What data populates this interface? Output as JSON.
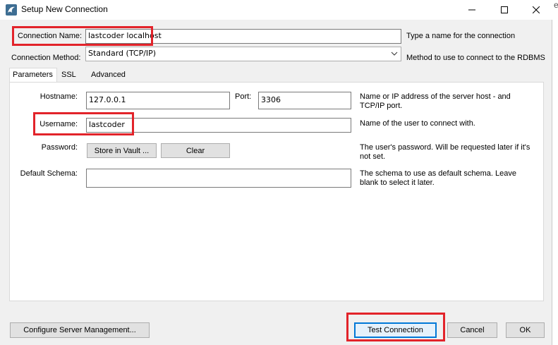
{
  "window": {
    "title": "Setup New Connection",
    "controls": {
      "minimize": "—",
      "maximize": "☐",
      "close": "✕"
    },
    "edge_char": "e"
  },
  "connection_name": {
    "label": "Connection Name:",
    "value": "lastcoder localhost",
    "hint": "Type a name for the connection"
  },
  "connection_method": {
    "label": "Connection Method:",
    "value": "Standard (TCP/IP)",
    "hint": "Method to use to connect to the RDBMS"
  },
  "tabs": [
    {
      "label": "Parameters",
      "active": true
    },
    {
      "label": "SSL",
      "active": false
    },
    {
      "label": "Advanced",
      "active": false
    }
  ],
  "parameters": {
    "hostname": {
      "label": "Hostname:",
      "value": "127.0.0.1"
    },
    "port": {
      "label": "Port:",
      "value": "3306"
    },
    "host_hint": "Name or IP address of the server host - and TCP/IP port.",
    "username": {
      "label": "Username:",
      "value": "lastcoder",
      "hint": "Name of the user to connect with."
    },
    "password": {
      "label": "Password:",
      "store_button": "Store in Vault ...",
      "clear_button": "Clear",
      "hint": "The user's password. Will be requested later if it's not set."
    },
    "default_schema": {
      "label": "Default Schema:",
      "value": "",
      "hint": "The schema to use as default schema. Leave blank to select it later."
    }
  },
  "footer": {
    "configure_button": "Configure Server Management...",
    "test_button": "Test Connection",
    "cancel_button": "Cancel",
    "ok_button": "OK"
  },
  "colors": {
    "highlight": "#e2232a",
    "window_bg": "#f0f0f0",
    "accent_border": "#0078d7"
  },
  "icons": {
    "app": "mysql-dolphin-icon",
    "dropdown": "chevron-down-icon"
  }
}
